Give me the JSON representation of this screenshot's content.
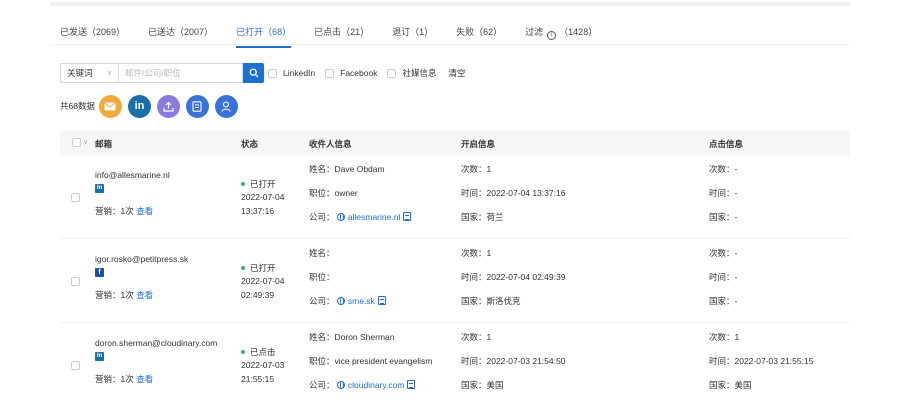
{
  "tabs": [
    {
      "label": "已发送（2069）"
    },
    {
      "label": "已送达（2007）"
    },
    {
      "label": "已打开（68）"
    },
    {
      "label": "已点击（21）"
    },
    {
      "label": "退订（1）"
    },
    {
      "label": "失败（62）"
    },
    {
      "label_pre": "过滤",
      "label_post": "（1428）"
    }
  ],
  "filter": {
    "select_value": "关键词",
    "input_placeholder": "邮件/公司/职位",
    "checkboxes": [
      "LinkedIn",
      "Facebook",
      "社媒信息"
    ],
    "clear_label": "清空"
  },
  "summary": {
    "count_label": "共68数据",
    "actions": [
      "mail-icon",
      "linkedin-icon",
      "upload-icon",
      "document-icon",
      "user-icon"
    ]
  },
  "table": {
    "headers": {
      "email": "邮箱",
      "status": "状态",
      "recipient": "收件人信息",
      "open": "开启信息",
      "click": "点击信息"
    },
    "rows": [
      {
        "email": "info@allesmarine.nl",
        "social": "linkedin",
        "marketing": "营销：1次",
        "view": "查看",
        "status": "已打开",
        "status_date": "2022-07-04",
        "status_time": "13:37:16",
        "name": "姓名：Dave Obdam",
        "title": "职位：owner",
        "company_label": "公司：",
        "company": "allesmarine.nl",
        "open_count": "次数：1",
        "open_time": "时间：2022-07-04 13:37:16",
        "open_country": "国家：荷兰",
        "click_count": "次数：-",
        "click_time": "时间：-",
        "click_country": "国家：-"
      },
      {
        "email": "igor.rosko@petitpress.sk",
        "social": "facebook",
        "marketing": "营销：1次",
        "view": "查看",
        "status": "已打开",
        "status_date": "2022-07-04",
        "status_time": "02:49:39",
        "name": "姓名：",
        "title": "职位：",
        "company_label": "公司：",
        "company": "sme.sk",
        "open_count": "次数：1",
        "open_time": "时间：2022-07-04 02:49:39",
        "open_country": "国家：斯洛伐克",
        "click_count": "次数：-",
        "click_time": "时间：-",
        "click_country": "国家：-"
      },
      {
        "email": "doron.sherman@cloudinary.com",
        "social": "linkedin",
        "marketing": "营销：1次",
        "view": "查看",
        "status": "已点击",
        "status_date": "2022-07-03",
        "status_time": "21:55:15",
        "name": "姓名：Doron Sherman",
        "title": "职位：vice president evangelism",
        "company_label": "公司：",
        "company": "cloudinary.com",
        "open_count": "次数：1",
        "open_time": "时间：2022-07-03 21:54:50",
        "open_country": "国家：美国",
        "click_count": "次数：1",
        "click_time": "时间：2022-07-03 21:55:15",
        "click_country": "国家：美国"
      }
    ]
  },
  "colors": {
    "accent": "#1f6fd1",
    "status_dot": "#38b26b",
    "mail_button": "#f0a93b",
    "linkedin": "#1b6fa8",
    "upload_button": "#8b7be0"
  }
}
